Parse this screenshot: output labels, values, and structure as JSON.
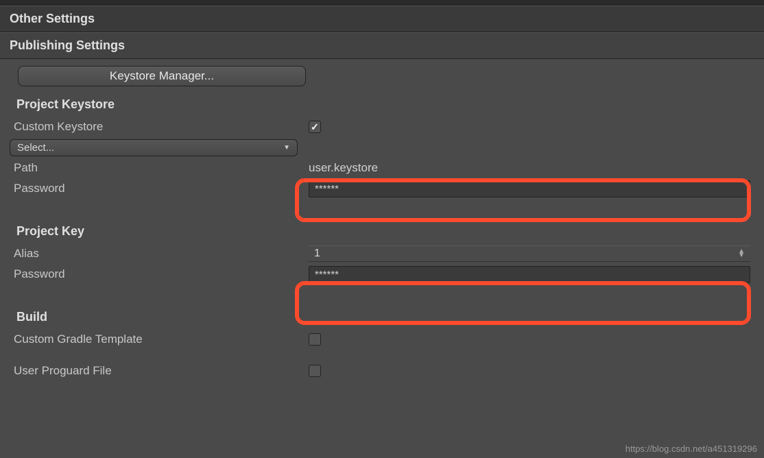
{
  "headers": {
    "other_settings": "Other Settings",
    "publishing_settings": "Publishing Settings"
  },
  "keystore_manager_btn": "Keystore Manager...",
  "project_keystore": {
    "title": "Project Keystore",
    "custom_keystore_label": "Custom Keystore",
    "custom_keystore_checked": true,
    "select_dropdown": "Select...",
    "path_label": "Path",
    "path_value": "user.keystore",
    "password_label": "Password",
    "password_value": "******"
  },
  "project_key": {
    "title": "Project Key",
    "alias_label": "Alias",
    "alias_value": "1",
    "password_label": "Password",
    "password_value": "******"
  },
  "build": {
    "title": "Build",
    "gradle_label": "Custom Gradle Template",
    "gradle_checked": false,
    "proguard_label": "User Proguard File",
    "proguard_checked": false
  },
  "watermark": "https://blog.csdn.net/a451319296"
}
